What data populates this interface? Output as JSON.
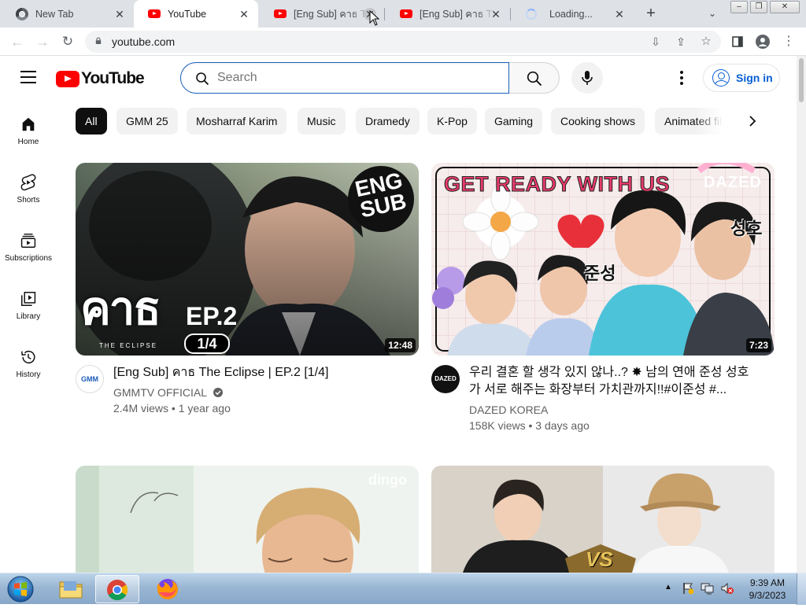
{
  "browser": {
    "tabs": [
      {
        "title": "New Tab",
        "favicon": "chrome-icon",
        "active": false
      },
      {
        "title": "YouTube",
        "favicon": "youtube-icon",
        "active": true
      },
      {
        "title": "[Eng Sub] คาธ The Eclipse",
        "favicon": "youtube-icon",
        "active": false
      },
      {
        "title": "[Eng Sub] คาธ The Eclipse",
        "favicon": "youtube-icon",
        "active": false
      },
      {
        "title": "Loading...",
        "favicon": "loading-icon",
        "active": false
      }
    ],
    "url": "youtube.com"
  },
  "youtube": {
    "logo_text": "YouTube",
    "search_placeholder": "Search",
    "signin_label": "Sign in",
    "guide": [
      {
        "label": "Home",
        "icon": "home-icon"
      },
      {
        "label": "Shorts",
        "icon": "shorts-icon"
      },
      {
        "label": "Subscriptions",
        "icon": "subscriptions-icon"
      },
      {
        "label": "Library",
        "icon": "library-icon"
      },
      {
        "label": "History",
        "icon": "history-icon"
      }
    ],
    "chips": [
      "All",
      "GMM 25",
      "Mosharraf Karim",
      "Music",
      "Dramedy",
      "K-Pop",
      "Gaming",
      "Cooking shows",
      "Animated films"
    ],
    "videos": [
      {
        "title": "[Eng Sub] คาธ The Eclipse | EP.2 [1/4]",
        "channel": "GMMTV OFFICIAL",
        "verified": true,
        "stats": "2.4M views • 1 year ago",
        "duration": "12:48",
        "thumb_text": {
          "badge": "ENG SUB",
          "logo": "คาธ",
          "ep": "EP.2",
          "part": "1/4",
          "sub": "THE ECLIPSE"
        },
        "avatar_text": "GMM"
      },
      {
        "title": "우리 결혼 할 생각 있지 않나..? ✸ 남의 연애 준성 성호가 서로 해주는 화장부터 가치관까지!!#이준성 #...",
        "channel": "DAZED KOREA",
        "verified": false,
        "stats_views": "158K views",
        "stats_age": "3 days ago",
        "duration": "7:23",
        "thumb_text": {
          "headline": "GET READY WITH US",
          "brand": "DAZED",
          "name1": "준성",
          "name2": "성호"
        },
        "avatar_text": "DAZED"
      },
      {
        "title": "",
        "channel": "",
        "duration": "",
        "thumb_text": {
          "brand": "dingo"
        }
      },
      {
        "title": "",
        "channel": "",
        "duration": "",
        "thumb_text": {
          "mark": "VS"
        }
      }
    ]
  },
  "taskbar": {
    "time": "9:39 AM",
    "date": "9/3/2023"
  }
}
